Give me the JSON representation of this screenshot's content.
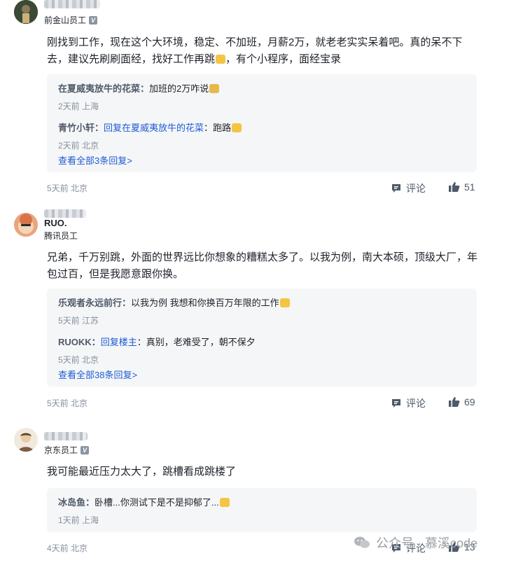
{
  "comments": [
    {
      "company": "前金山员工",
      "content": "刚找到工作，现在这个大环境，稳定、不加班，月薪2万，就老老实实呆着吧。真的呆不下去，建议先刷刷面经，找好工作再跳",
      "content_tail": "，有个小程序，面经宝录",
      "replies": [
        {
          "name": "在夏威夷放牛的花菜",
          "text": "加班的2万咋说",
          "meta": "2天前 上海"
        },
        {
          "name": "青竹小轩",
          "reply_to": "回复在夏威夷放牛的花菜",
          "text": "跑路",
          "meta": "2天前 北京"
        }
      ],
      "view_all": "查看全部3条回复>",
      "meta": "5天前 北京",
      "comment_label": "评论",
      "likes": "51"
    },
    {
      "username": "RUO.",
      "company": "腾讯员工",
      "content": "兄弟，千万别跳，外面的世界远比你想象的糟糕太多了。以我为例，南大本硕，顶级大厂，年包过百，但是我愿意跟你换。",
      "replies": [
        {
          "name": "乐观者永远前行",
          "text": "以我为例 我想和你换百万年限的工作",
          "meta": "5天前 江苏"
        },
        {
          "name": "RUOKK",
          "reply_to": "回复楼主",
          "text": "真别，老难受了，朝不保夕",
          "meta": "5天前 北京"
        }
      ],
      "view_all": "查看全部38条回复>",
      "meta": "5天前 北京",
      "comment_label": "评论",
      "likes": "69"
    },
    {
      "company": "京东员工",
      "content": "我可能最近压力太大了，跳槽看成跳楼了",
      "replies": [
        {
          "name": "冰岛鱼",
          "text": "卧槽...你测试下是不是抑郁了...",
          "meta": "1天前 上海"
        }
      ],
      "meta": "4天前 北京",
      "comment_label": "评论",
      "likes": "13"
    }
  ],
  "watermark": "公众号 · 慕溪code",
  "colors": {
    "link": "#1e5bd6",
    "meta": "#86909c",
    "reply_bg": "#f5f6f7"
  }
}
